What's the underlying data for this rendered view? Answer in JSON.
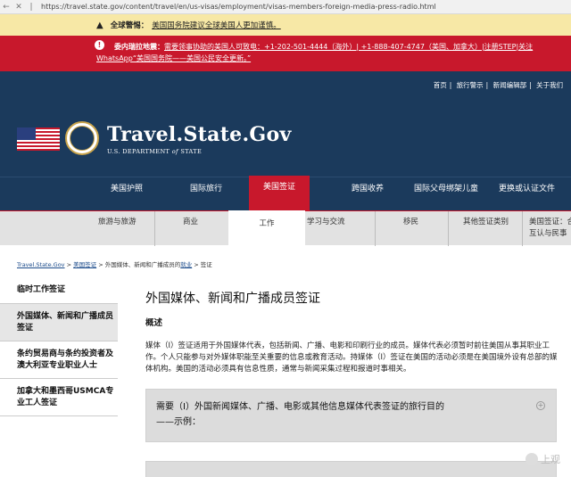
{
  "browser": {
    "back_icon": "back-arrow-icon",
    "close_icon": "close-icon",
    "url": "https://travel.state.gov/content/travel/en/us-visas/employment/visas-members-foreign-media-press-radio.html"
  },
  "alerts": {
    "global": {
      "label": "全球警惕：",
      "text": "美国国务院建议全球美国人更加谨慎。"
    },
    "venezuela": {
      "label": "委内瑞拉地震：",
      "text1": "需要领事协助的美国人可致电：+1-202-501-4444（海外）| +1-888-407-4747（美国、加拿大）|注册STEP|关注",
      "text2": "WhatsApp“美国国务院——美国公民安全更新。”"
    }
  },
  "header": {
    "top_links": [
      "首页",
      "旅行警示",
      "新闻编辑部",
      "关于我们"
    ],
    "brand": "Travel.State.Gov",
    "brand_sub_prefix": "U.S. DEPARTMENT ",
    "brand_sub_of": "of",
    "brand_sub_suffix": " STATE"
  },
  "main_nav": [
    "美国护照",
    "国际旅行",
    "美国签证",
    "跨国收养",
    "国际父母绑架儿童",
    "更换或认证文件"
  ],
  "sub_nav": [
    "旅游与旅游",
    "商业",
    "工作",
    "学习与交流",
    "移民",
    "其他签证类别",
    "美国签证：合",
    "互认与民事"
  ],
  "breadcrumb": {
    "home": "Travel.State.Gov",
    "sep1": " > ",
    "visa": "美国签证",
    "sep2": " > ",
    "mid": "外国媒体、新闻和广播成员的",
    "work": "就业",
    "tail": " > 签证"
  },
  "sidebar": [
    "临时工作签证",
    "外国媒体、新闻和广播成员签证",
    "条约贸易商与条约投资者及澳大利亚专业职业人士",
    "加拿大和墨西哥USMCA专业工人签证"
  ],
  "content": {
    "title": "外国媒体、新闻和广播成员签证",
    "overview": "概述",
    "paragraph": "媒体（I）签证适用于外国媒体代表，包括新闻、广播、电影和印刷行业的成员。媒体代表必须暂时前往美国从事其职业工作。个人只能参与对外媒体职能至关重要的信息或教育活动。持媒体（I）签证在美国的活动必须是在美国境外设有总部的媒体机构。美国的活动必须具有信息性质，通常与新闻采集过程和报道时事相关。",
    "accordion1_line1": "需要（I）外国新闻媒体、广播、电影或其他信息媒体代表签证的旅行目的",
    "accordion1_line2": "——示例：",
    "plus_icon": "plus-circle-icon"
  },
  "watermark": "上观"
}
